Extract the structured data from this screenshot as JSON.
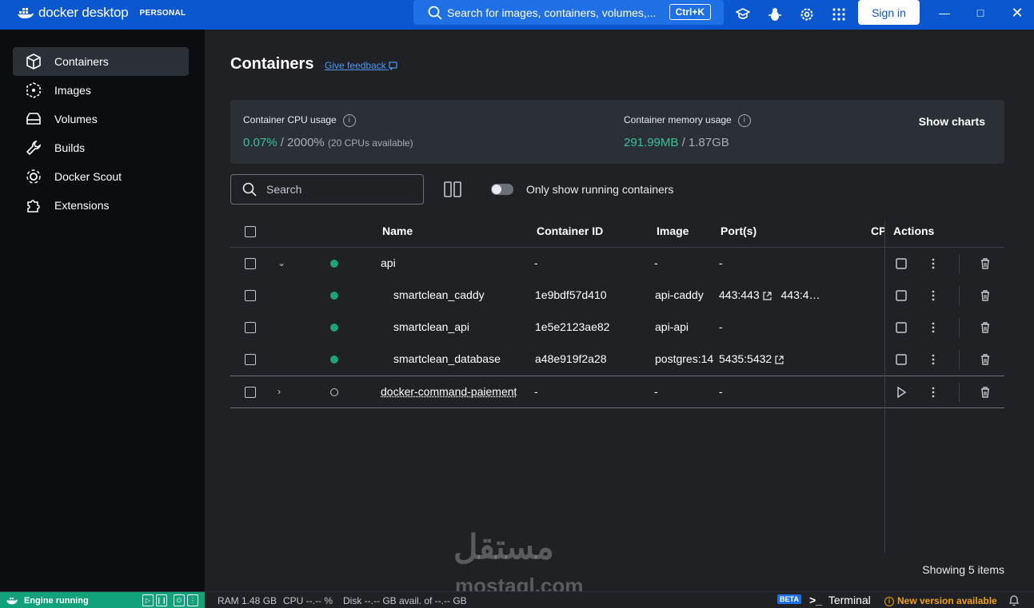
{
  "app": {
    "brand": "docker desktop",
    "plan": "PERSONAL"
  },
  "topbar": {
    "search_text": "Search for images, containers, volumes,...",
    "shortcut": "Ctrl+K",
    "signin_label": "Sign in"
  },
  "sidebar": {
    "items": [
      {
        "label": "Containers",
        "icon": "container-icon",
        "active": true
      },
      {
        "label": "Images",
        "icon": "images-icon",
        "active": false
      },
      {
        "label": "Volumes",
        "icon": "volumes-icon",
        "active": false
      },
      {
        "label": "Builds",
        "icon": "wrench-icon",
        "active": false
      },
      {
        "label": "Docker Scout",
        "icon": "scout-icon",
        "active": false
      },
      {
        "label": "Extensions",
        "icon": "puzzle-icon",
        "active": false
      }
    ]
  },
  "main": {
    "title": "Containers",
    "feedback": "Give feedback",
    "stats": {
      "cpu_label": "Container CPU usage",
      "cpu_used": "0.07%",
      "cpu_total": "/ 2000%",
      "cpu_note": "(20 CPUs available)",
      "mem_label": "Container memory usage",
      "mem_used": "291.99MB",
      "mem_total": "/ 1.87GB",
      "show_charts": "Show charts"
    },
    "search_placeholder": "Search",
    "toggle_label": "Only show running containers",
    "columns": [
      "Name",
      "Container ID",
      "Image",
      "Port(s)",
      "CP",
      "Actions"
    ],
    "rows": [
      {
        "name": "api",
        "id": "-",
        "image": "-",
        "ports": "-",
        "status": "running",
        "group": true,
        "expanded": true
      },
      {
        "name": "smartclean_caddy",
        "id": "1e9bdf57d410",
        "image": "api-caddy",
        "ports": "443:443",
        "ports2": "443:4…",
        "status": "running",
        "child": true
      },
      {
        "name": "smartclean_api",
        "id": "1e5e2123ae82",
        "image": "api-api",
        "ports": "-",
        "status": "running",
        "child": true
      },
      {
        "name": "smartclean_database",
        "id": "a48e919f2a28",
        "image": "postgres:14",
        "ports": "5435:5432",
        "status": "running",
        "child": true
      },
      {
        "name": "docker-command-paiement",
        "id": "-",
        "image": "-",
        "ports": "-",
        "status": "stopped",
        "group": true,
        "expanded": false
      }
    ],
    "showing": "Showing 5 items"
  },
  "statusbar": {
    "engine": "Engine running",
    "ram": "RAM 1.48 GB",
    "cpu": "CPU --.-- %",
    "disk": "Disk --.-- GB avail. of --.-- GB",
    "beta": "BETA",
    "terminal": "Terminal",
    "new_version": "New version available"
  },
  "watermark": {
    "arabic": "مستقل",
    "latin": "mostaql.com"
  },
  "colors": {
    "brand_blue": "#0b57d0",
    "running_green": "#1fa37a",
    "stat_green": "#35c29a",
    "warning": "#f0a30a"
  }
}
